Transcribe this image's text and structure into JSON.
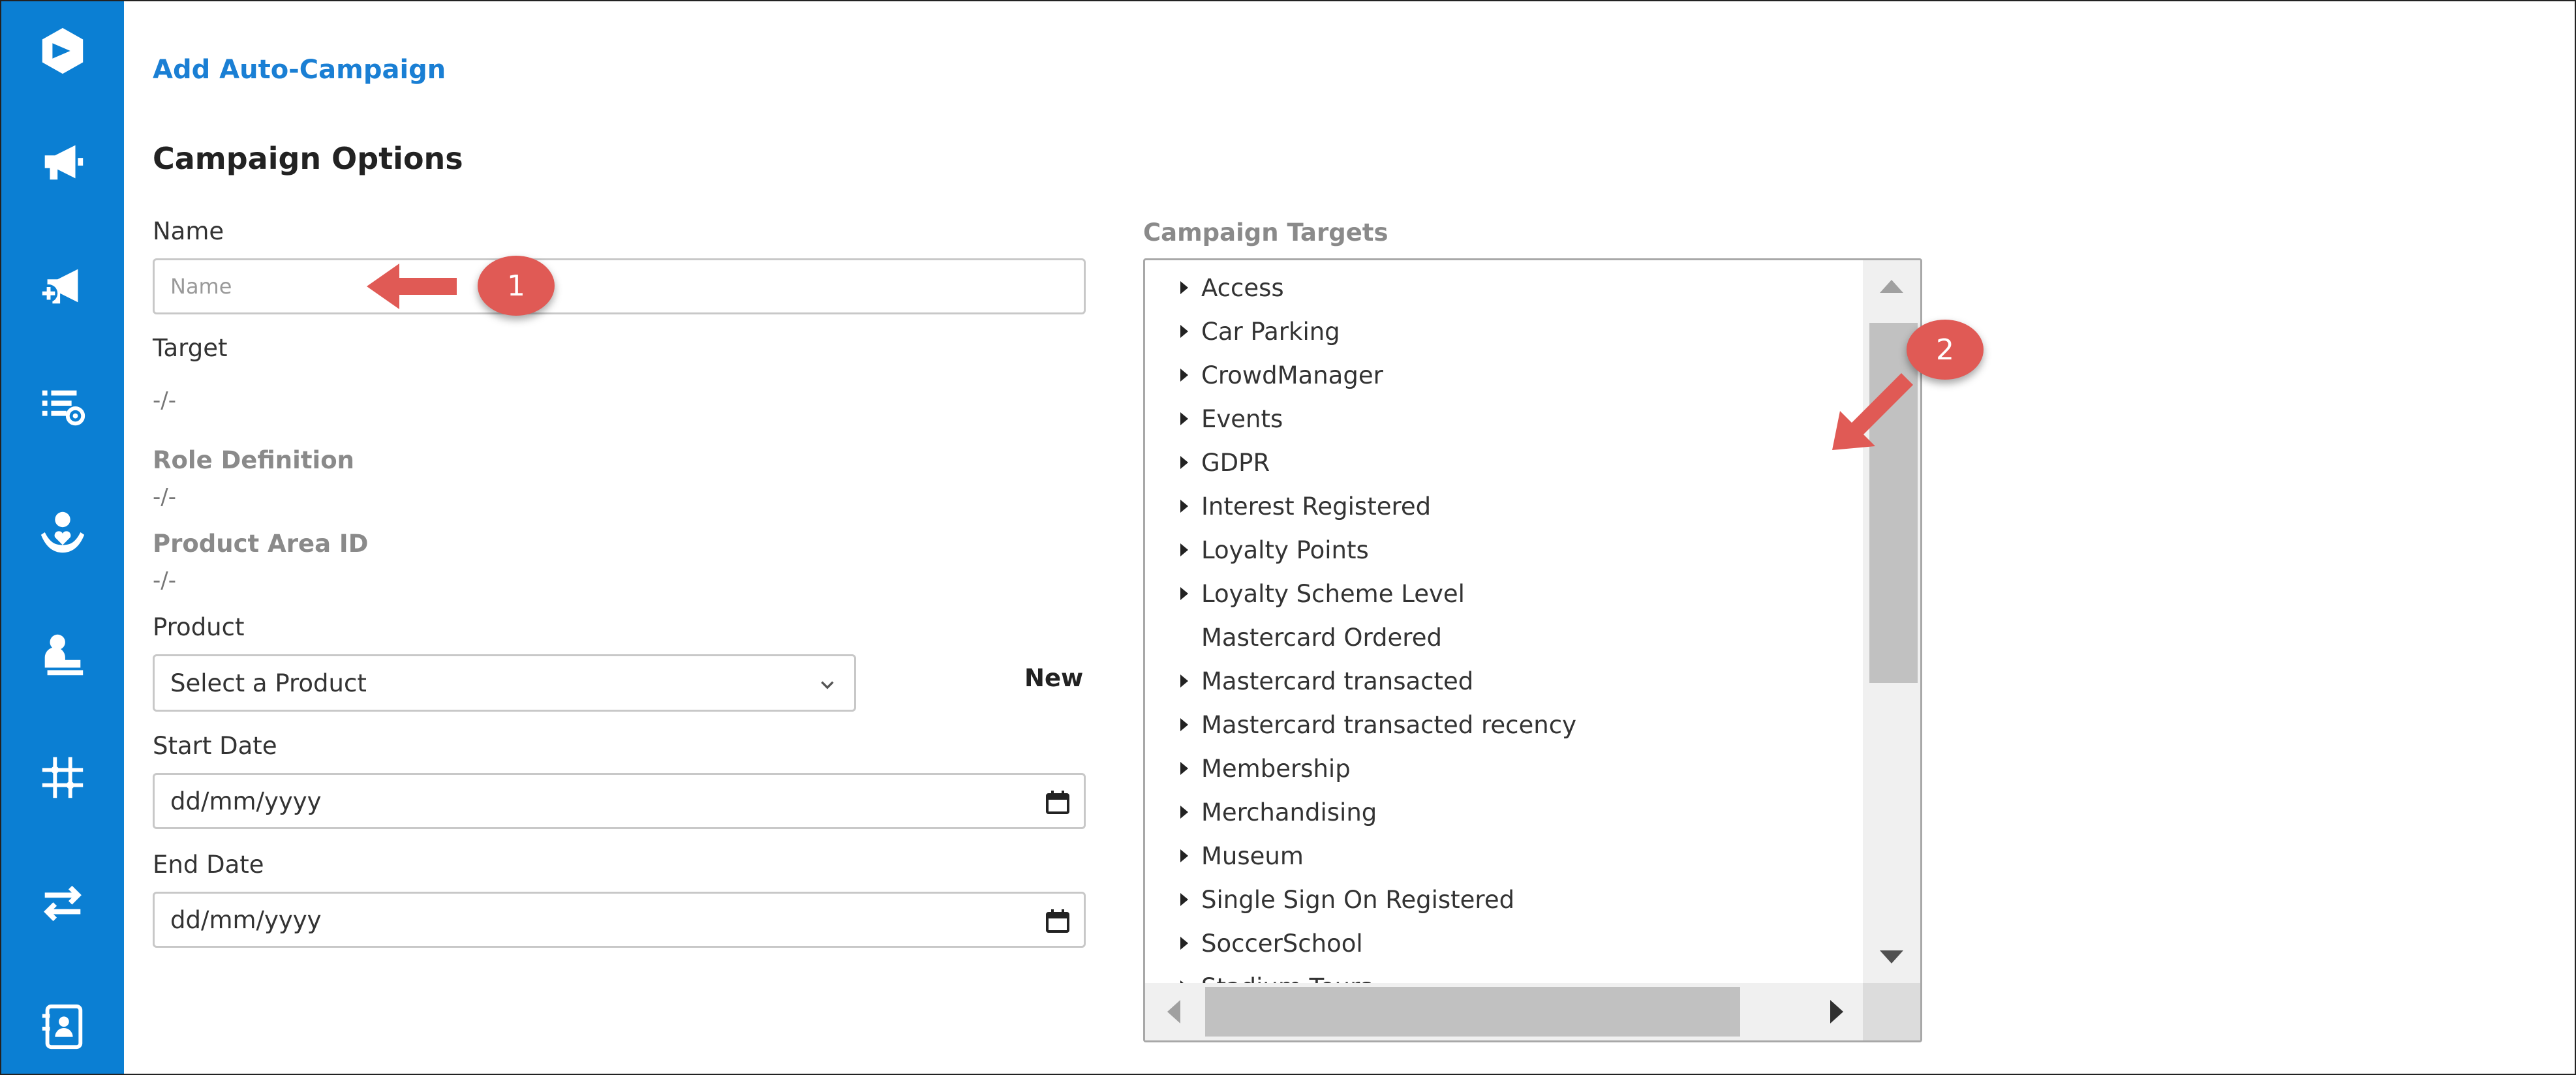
{
  "header": {
    "title": "Add Auto-Campaign"
  },
  "section": {
    "title": "Campaign Options"
  },
  "form": {
    "name_label": "Name",
    "name_placeholder": "Name",
    "target_label": "Target",
    "target_value": "-/-",
    "role_label": "Role Definition",
    "role_value": "-/-",
    "product_area_label": "Product Area ID",
    "product_area_value": "-/-",
    "product_label": "Product",
    "product_select": "Select a Product",
    "new_label": "New",
    "start_label": "Start Date",
    "start_value": "dd/mm/yyyy",
    "end_label": "End Date",
    "end_value": "dd/mm/yyyy"
  },
  "targets": {
    "label": "Campaign Targets",
    "items": [
      {
        "label": "Access",
        "expandable": true
      },
      {
        "label": "Car Parking",
        "expandable": true
      },
      {
        "label": "CrowdManager",
        "expandable": true
      },
      {
        "label": "Events",
        "expandable": true
      },
      {
        "label": "GDPR",
        "expandable": true
      },
      {
        "label": "Interest Registered",
        "expandable": true
      },
      {
        "label": "Loyalty Points",
        "expandable": true
      },
      {
        "label": "Loyalty Scheme Level",
        "expandable": true
      },
      {
        "label": "Mastercard Ordered",
        "expandable": false
      },
      {
        "label": "Mastercard transacted",
        "expandable": true
      },
      {
        "label": "Mastercard transacted recency",
        "expandable": true
      },
      {
        "label": "Membership",
        "expandable": true
      },
      {
        "label": "Merchandising",
        "expandable": true
      },
      {
        "label": "Museum",
        "expandable": true
      },
      {
        "label": "Single Sign On Registered",
        "expandable": true
      },
      {
        "label": "SoccerSchool",
        "expandable": true
      },
      {
        "label": "Stadium Tours",
        "expandable": true
      }
    ]
  },
  "callouts": {
    "one": "1",
    "two": "2"
  },
  "sidebar": {
    "icons": [
      "logo-icon",
      "megaphone-icon",
      "megaphone-add-icon",
      "list-settings-icon",
      "user-heart-icon",
      "user-desk-icon",
      "grid-icon",
      "transfer-icon",
      "contact-book-icon"
    ]
  },
  "colors": {
    "sidebar": "#0b7fd3",
    "accent": "#1a7fd4",
    "callout": "#e05a55"
  }
}
